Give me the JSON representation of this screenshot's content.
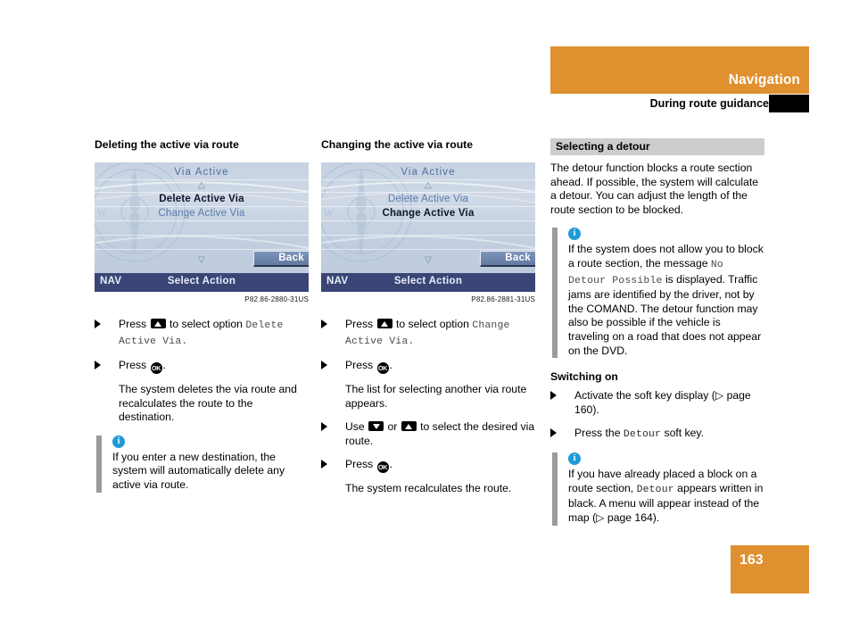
{
  "header": {
    "title": "Navigation",
    "subtitle": "During route guidance"
  },
  "page_number": "163",
  "left_column": {
    "heading": "Deleting the active via route",
    "screen": {
      "title": "Via Active",
      "up_arrow": "△",
      "down_arrow": "▽",
      "row1": "Delete Active Via",
      "row2": "Change Active Via",
      "back_label": "Back",
      "status_left": "NAV",
      "status_center": "Select Action"
    },
    "caption": "P82.86-2880-31US",
    "step1_pre": "Press",
    "step1_mid": "to select option",
    "step1_mono": "Delete Active Via.",
    "step2_pre": "Press",
    "step2_post": ".",
    "result1": "The system deletes the via route and recalculates the route to the destination.",
    "note": {
      "icon": "i",
      "text": "If you enter a new destination, the system will automatically delete any active via route."
    }
  },
  "middle_column": {
    "heading": "Changing the active via route",
    "screen": {
      "title": "Via Active",
      "up_arrow": "△",
      "down_arrow": "▽",
      "row1": "Delete Active Via",
      "row2": "Change Active Via",
      "back_label": "Back",
      "status_left": "NAV",
      "status_center": "Select Action"
    },
    "caption": "P82.86-2881-31US",
    "step1_pre": "Press",
    "step1_mid": "to select option",
    "step1_mono": "Change Active Via.",
    "step2_pre": "Press",
    "step2_post": ".",
    "result1": "The list for selecting another via route appears.",
    "step3_pre": "Use",
    "step3_or": "or",
    "step3_post": "to select the desired via route.",
    "step4_pre": "Press",
    "step4_post": ".",
    "result2": "The system recalculates the route."
  },
  "right_column": {
    "section_title": "Selecting a detour",
    "intro": "The detour function blocks a route section ahead. If possible, the system will calculate a detour. You can adjust the length of the route section to be blocked.",
    "note1": {
      "icon": "i",
      "part1": "If the system does not allow you to block a route section, the message",
      "mono": "No Detour Possible",
      "part2": "is displayed. Traffic jams are identified by the driver, not by the COMAND. The detour function may also be possible if the vehicle is traveling on a road that does not appear on the DVD."
    },
    "switching_heading": "Switching on",
    "step1": "Activate the soft key display (▷ page 160).",
    "step2_pre": "Press the",
    "step2_mono": "Detour",
    "step2_post": "soft key.",
    "note2": {
      "icon": "i",
      "part1": "If you have already placed a block on a route section,",
      "mono": "Detour",
      "part2": "appears written in black. A menu will appear instead of the map (▷ page 164)."
    }
  },
  "colors": {
    "accent_orange": "#e0902f",
    "section_gray": "#cdcdcd",
    "note_bar_gray": "#9b9b9b",
    "info_blue": "#1f9bd8",
    "screen_status_navy": "#3a4576"
  }
}
